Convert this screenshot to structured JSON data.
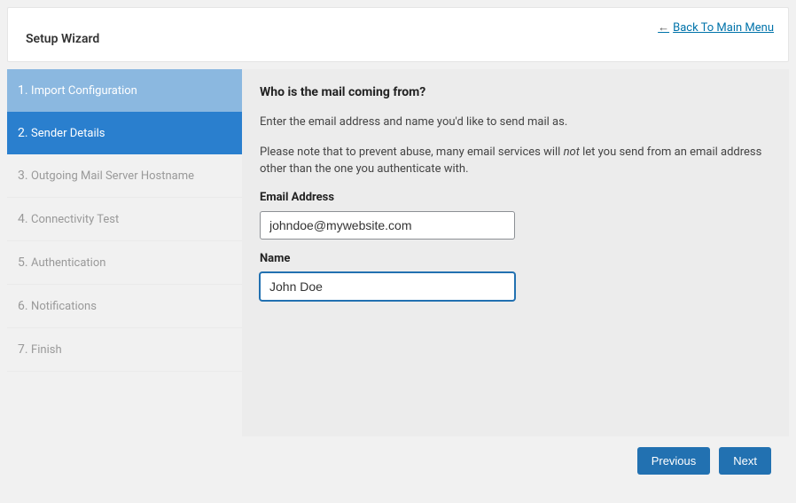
{
  "header": {
    "title": "Setup Wizard",
    "back_link_prefix": "←",
    "back_link": "Back To Main Menu"
  },
  "steps": [
    {
      "num": "1.",
      "label": "Import Configuration",
      "state": "completed"
    },
    {
      "num": "2.",
      "label": "Sender Details",
      "state": "active"
    },
    {
      "num": "3.",
      "label": "Outgoing Mail Server Hostname",
      "state": ""
    },
    {
      "num": "4.",
      "label": "Connectivity Test",
      "state": ""
    },
    {
      "num": "5.",
      "label": "Authentication",
      "state": ""
    },
    {
      "num": "6.",
      "label": "Notifications",
      "state": ""
    },
    {
      "num": "7.",
      "label": "Finish",
      "state": ""
    }
  ],
  "panel": {
    "heading": "Who is the mail coming from?",
    "intro": "Enter the email address and name you'd like to send mail as.",
    "note_pre": "Please note that to prevent abuse, many email services will ",
    "note_em": "not",
    "note_post": " let you send from an email address other than the one you authenticate with.",
    "email_label": "Email Address",
    "email_value": "johndoe@mywebsite.com",
    "name_label": "Name",
    "name_value": "John Doe"
  },
  "buttons": {
    "previous": "Previous",
    "next": "Next"
  }
}
